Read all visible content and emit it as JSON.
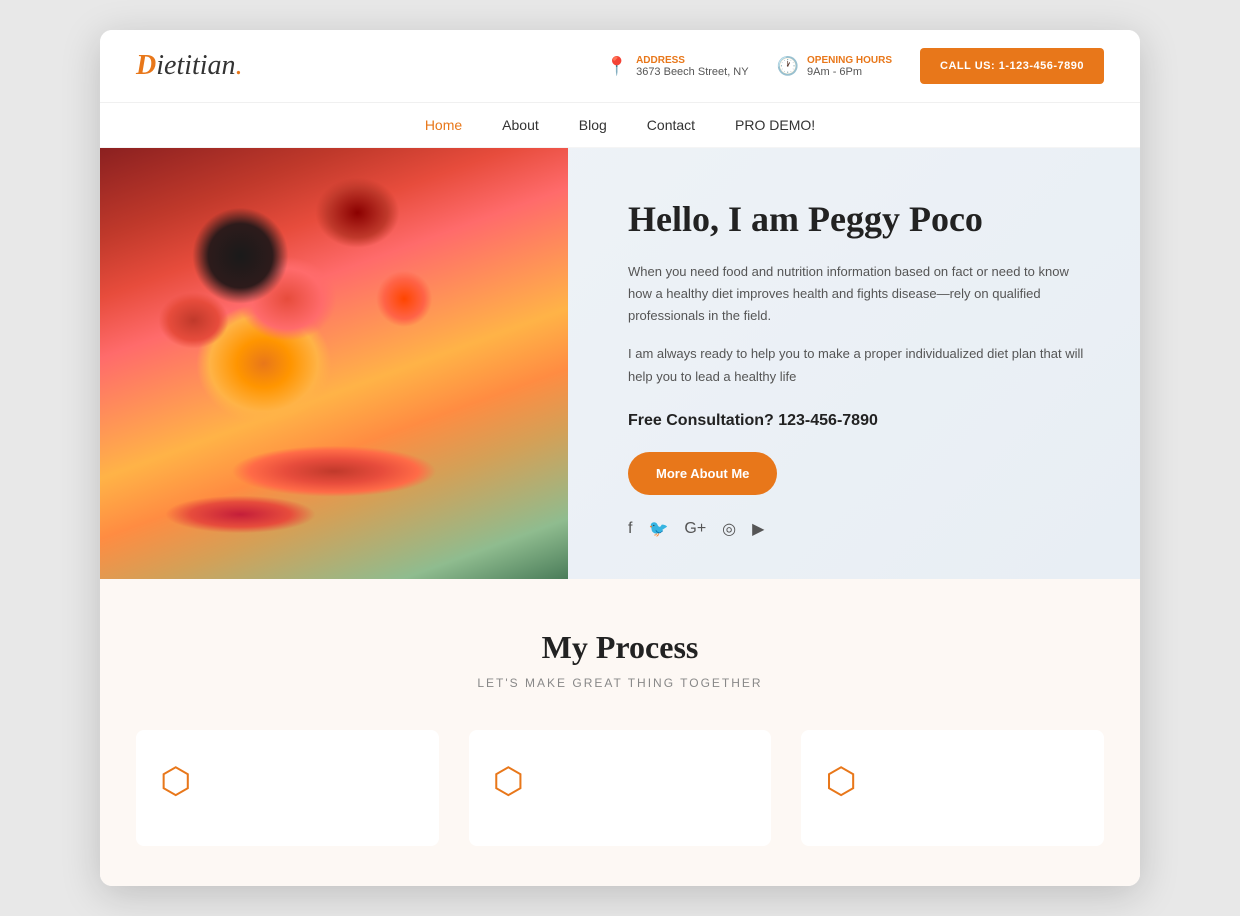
{
  "logo": {
    "d": "D",
    "rest": "ietitian",
    "dot": "."
  },
  "topbar": {
    "address_label": "Address",
    "address_value": "3673 Beech Street, NY",
    "hours_label": "Opening Hours",
    "hours_value": "9Am - 6Pm",
    "call_button": "CALL US: 1-123-456-7890"
  },
  "nav": {
    "items": [
      {
        "label": "Home",
        "active": true
      },
      {
        "label": "About",
        "active": false
      },
      {
        "label": "Blog",
        "active": false
      },
      {
        "label": "Contact",
        "active": false
      },
      {
        "label": "PRO DEMO!",
        "active": false
      }
    ]
  },
  "hero": {
    "title": "Hello, I am Peggy Poco",
    "desc1": "When you need food and nutrition information based on fact or need to know how a healthy diet improves health and fights disease—rely on qualified professionals in the field.",
    "desc2": " I am always ready to help you to make a proper individualized diet plan that will help you to lead a healthy life",
    "consultation": "Free Consultation? 123-456-7890",
    "more_button": "More About Me",
    "social": {
      "facebook": "f",
      "twitter": "t",
      "googleplus": "G+",
      "instagram": "IG",
      "youtube": "▶"
    }
  },
  "process": {
    "title": "My Process",
    "subtitle": "LET'S MAKE GREAT THING TOGETHER",
    "card1_icon": "⬡",
    "card2_icon": "⬡",
    "card3_icon": "⬡"
  }
}
